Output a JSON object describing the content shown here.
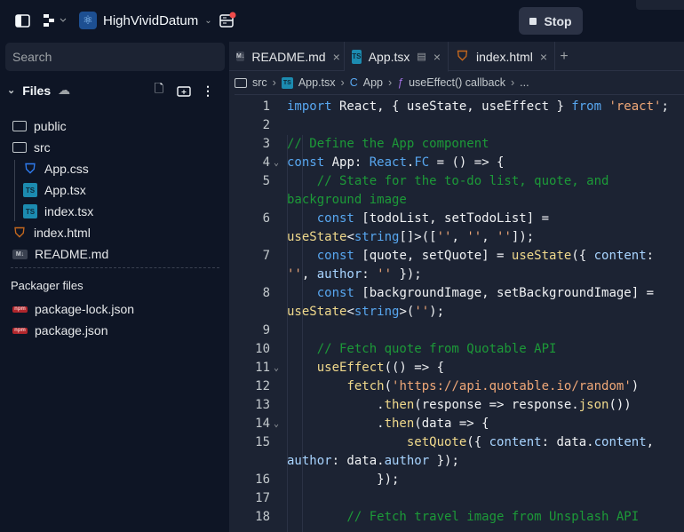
{
  "topbar": {
    "project_name": "HighVividDatum",
    "stop_label": "Stop",
    "notification_dot_color": "#f04b4b"
  },
  "sidebar": {
    "search_placeholder": "Search",
    "files_label": "Files",
    "tree": [
      {
        "name": "public",
        "icon": "folder"
      },
      {
        "name": "src",
        "icon": "folder-open"
      },
      {
        "name": "App.css",
        "icon": "css"
      },
      {
        "name": "App.tsx",
        "icon": "ts"
      },
      {
        "name": "index.tsx",
        "icon": "ts"
      },
      {
        "name": "index.html",
        "icon": "html"
      },
      {
        "name": "README.md",
        "icon": "md"
      }
    ],
    "packager_label": "Packager files",
    "packager": [
      {
        "name": "package-lock.json"
      },
      {
        "name": "package.json"
      }
    ]
  },
  "tabs": [
    {
      "label": "README.md",
      "icon": "md"
    },
    {
      "label": "App.tsx",
      "icon": "ts"
    },
    {
      "label": "index.html",
      "icon": "html"
    }
  ],
  "breadcrumb": {
    "folder": "src",
    "file": "App.tsx",
    "component": "App",
    "function": "useEffect() callback",
    "more": "..."
  },
  "code": [
    {
      "n": "1",
      "t": [
        [
          "k",
          "import"
        ],
        [
          "t",
          " React, { useState, useEffect } "
        ],
        [
          "k",
          "from"
        ],
        [
          "t",
          " "
        ],
        [
          "s",
          "'react'"
        ],
        [
          "t",
          ";"
        ]
      ]
    },
    {
      "n": "2",
      "t": []
    },
    {
      "n": "3",
      "t": [
        [
          "c",
          "// Define the App component"
        ]
      ]
    },
    {
      "n": "4",
      "fold": true,
      "t": [
        [
          "k",
          "const"
        ],
        [
          "t",
          " App: "
        ],
        [
          "k",
          "React"
        ],
        [
          "t",
          "."
        ],
        [
          "k",
          "FC"
        ],
        [
          "t",
          " = () => {"
        ]
      ]
    },
    {
      "n": "5",
      "t": [
        [
          "c",
          "    // State for the to-do list, quote, and"
        ]
      ]
    },
    {
      "n": "",
      "t": [
        [
          "c",
          "background image"
        ]
      ]
    },
    {
      "n": "6",
      "t": [
        [
          "t",
          "    "
        ],
        [
          "k",
          "const"
        ],
        [
          "t",
          " [todoList, setTodoList] ="
        ]
      ]
    },
    {
      "n": "",
      "t": [
        [
          "f",
          "useState"
        ],
        [
          "t",
          "<"
        ],
        [
          "k",
          "string"
        ],
        [
          "t",
          "[]>(["
        ],
        [
          "s",
          "''"
        ],
        [
          "t",
          ", "
        ],
        [
          "s",
          "''"
        ],
        [
          "t",
          ", "
        ],
        [
          "s",
          "''"
        ],
        [
          "t",
          "]);"
        ]
      ]
    },
    {
      "n": "7",
      "t": [
        [
          "t",
          "    "
        ],
        [
          "k",
          "const"
        ],
        [
          "t",
          " [quote, setQuote] = "
        ],
        [
          "f",
          "useState"
        ],
        [
          "t",
          "({ "
        ],
        [
          "p",
          "content"
        ],
        [
          "t",
          ":"
        ]
      ]
    },
    {
      "n": "",
      "t": [
        [
          "s",
          "''"
        ],
        [
          "t",
          ", "
        ],
        [
          "p",
          "author"
        ],
        [
          "t",
          ": "
        ],
        [
          "s",
          "''"
        ],
        [
          "t",
          " });"
        ]
      ]
    },
    {
      "n": "8",
      "t": [
        [
          "t",
          "    "
        ],
        [
          "k",
          "const"
        ],
        [
          "t",
          " [backgroundImage, setBackgroundImage] ="
        ]
      ]
    },
    {
      "n": "",
      "t": [
        [
          "f",
          "useState"
        ],
        [
          "t",
          "<"
        ],
        [
          "k",
          "string"
        ],
        [
          "t",
          ">("
        ],
        [
          "s",
          "''"
        ],
        [
          "t",
          ");"
        ]
      ]
    },
    {
      "n": "9",
      "t": []
    },
    {
      "n": "10",
      "t": [
        [
          "c",
          "    // Fetch quote from Quotable API"
        ]
      ]
    },
    {
      "n": "11",
      "fold": true,
      "t": [
        [
          "t",
          "    "
        ],
        [
          "f",
          "useEffect"
        ],
        [
          "t",
          "(() => {"
        ]
      ]
    },
    {
      "n": "12",
      "t": [
        [
          "t",
          "        "
        ],
        [
          "f",
          "fetch"
        ],
        [
          "t",
          "("
        ],
        [
          "s",
          "'https://api.quotable.io/random'"
        ],
        [
          "t",
          ")"
        ]
      ]
    },
    {
      "n": "13",
      "t": [
        [
          "t",
          "            ."
        ],
        [
          "f",
          "then"
        ],
        [
          "t",
          "(response => response."
        ],
        [
          "f",
          "json"
        ],
        [
          "t",
          "())"
        ]
      ]
    },
    {
      "n": "14",
      "fold": true,
      "t": [
        [
          "t",
          "            ."
        ],
        [
          "f",
          "then"
        ],
        [
          "t",
          "(data => {"
        ]
      ]
    },
    {
      "n": "15",
      "t": [
        [
          "t",
          "                "
        ],
        [
          "f",
          "setQuote"
        ],
        [
          "t",
          "({ "
        ],
        [
          "p",
          "content"
        ],
        [
          "t",
          ": data."
        ],
        [
          "p",
          "content"
        ],
        [
          "t",
          ","
        ]
      ]
    },
    {
      "n": "",
      "t": [
        [
          "p",
          "author"
        ],
        [
          "t",
          ": data."
        ],
        [
          "p",
          "author"
        ],
        [
          "t",
          " });"
        ]
      ]
    },
    {
      "n": "16",
      "t": [
        [
          "t",
          "            });"
        ]
      ]
    },
    {
      "n": "17",
      "t": []
    },
    {
      "n": "18",
      "t": [
        [
          "c",
          "        // Fetch travel image from Unsplash API"
        ]
      ]
    }
  ]
}
